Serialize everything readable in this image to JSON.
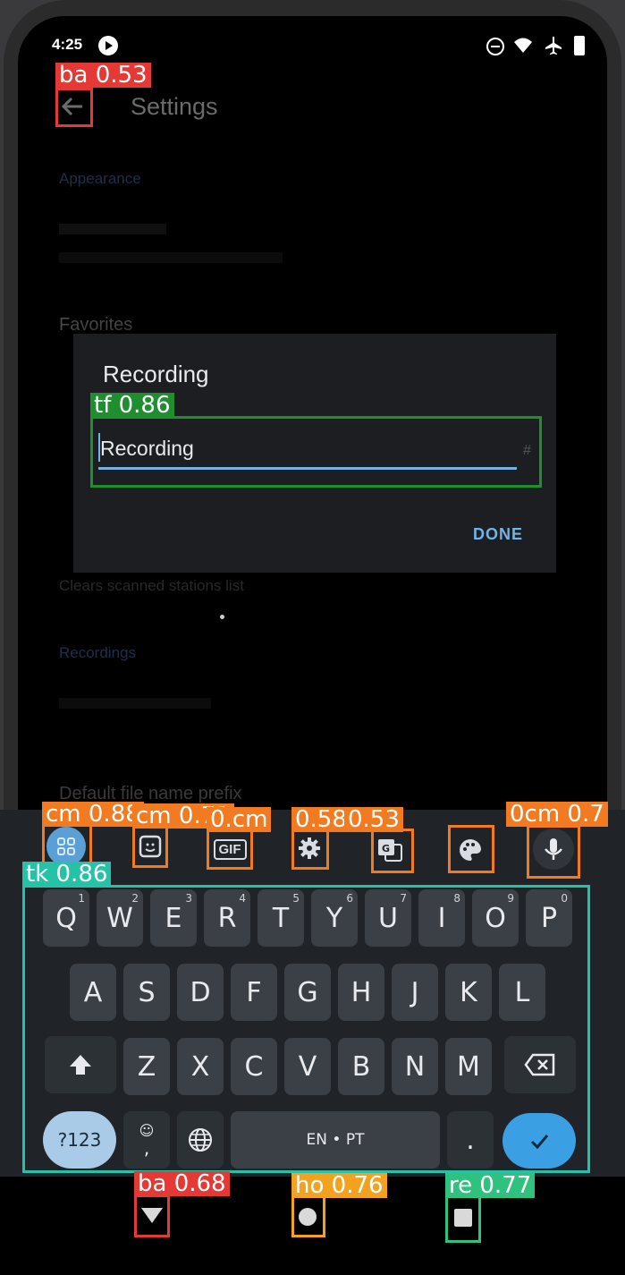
{
  "status_bar": {
    "time": "4:25"
  },
  "header": {
    "title": "Settings"
  },
  "background_settings": {
    "appearance_heading": "Appearance",
    "favorites_label": "Favorites",
    "reset_desc": "Clears scanned stations list",
    "recordings_heading": "Recordings",
    "prefix_label": "Default file name prefix"
  },
  "dialog": {
    "title": "Recording",
    "input_value": "Recording",
    "input_hint_char": "#",
    "done_label": "DONE"
  },
  "keyboard": {
    "row1": [
      {
        "key": "Q",
        "num": "1"
      },
      {
        "key": "W",
        "num": "2"
      },
      {
        "key": "E",
        "num": "3"
      },
      {
        "key": "R",
        "num": "4"
      },
      {
        "key": "T",
        "num": "5"
      },
      {
        "key": "Y",
        "num": "6"
      },
      {
        "key": "U",
        "num": "7"
      },
      {
        "key": "I",
        "num": "8"
      },
      {
        "key": "O",
        "num": "9"
      },
      {
        "key": "P",
        "num": "0"
      }
    ],
    "row2": [
      "A",
      "S",
      "D",
      "F",
      "G",
      "H",
      "J",
      "K",
      "L"
    ],
    "row3": [
      "Z",
      "X",
      "C",
      "V",
      "B",
      "N",
      "M"
    ],
    "symbols_label": "?123",
    "comma_label": ",",
    "space_label": "EN • PT",
    "period_label": ".",
    "gif_label": "GIF"
  },
  "detections": [
    {
      "id": "ba1",
      "label": "ba 0.53",
      "color": "#e53935"
    },
    {
      "id": "tf",
      "label": "tf 0.86",
      "color": "#1e8e2e"
    },
    {
      "id": "cm1",
      "label": "cm 0.88",
      "color": "#f27a21"
    },
    {
      "id": "cm2",
      "label": "cm 0.71",
      "color": "#f27a21"
    },
    {
      "id": "cm3",
      "label": "0.cm",
      "color": "#f27a21"
    },
    {
      "id": "cm4",
      "label": "0.58",
      "color": "#f27a21"
    },
    {
      "id": "cm5",
      "label": "0.53",
      "color": "#f27a21"
    },
    {
      "id": "cm6",
      "label": "0cm 0.7",
      "color": "#f27a21"
    },
    {
      "id": "tk",
      "label": "tk 0.86",
      "color": "#26c2a8"
    },
    {
      "id": "ba2",
      "label": "ba 0.68",
      "color": "#e53935"
    },
    {
      "id": "ho",
      "label": "ho 0.76",
      "color": "#f2a21f"
    },
    {
      "id": "re",
      "label": "re 0.77",
      "color": "#2ec27e"
    }
  ]
}
